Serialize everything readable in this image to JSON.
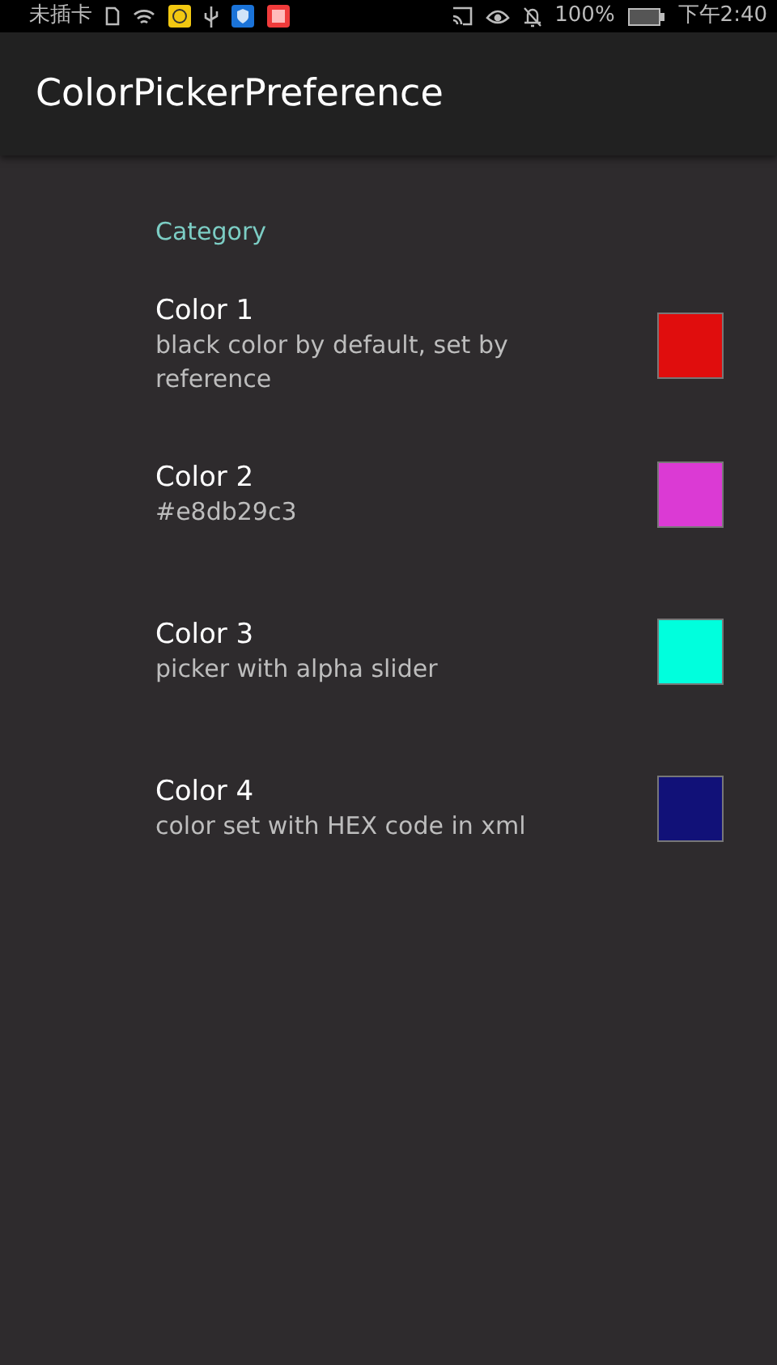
{
  "status_bar": {
    "carrier": "未插卡",
    "battery": "100%",
    "time": "下午2:40"
  },
  "app_bar": {
    "title": "ColorPickerPreference"
  },
  "category": "Category",
  "preferences": [
    {
      "title": "Color 1",
      "summary": "black color by default, set by reference",
      "color": "#e00d0d"
    },
    {
      "title": "Color 2",
      "summary": "#e8db29c3",
      "color": "#db3ad4"
    },
    {
      "title": "Color 3",
      "summary": "picker with alpha slider",
      "color": "#00ffdd"
    },
    {
      "title": "Color 4",
      "summary": "color set with HEX code in xml",
      "color": "#111178"
    }
  ]
}
